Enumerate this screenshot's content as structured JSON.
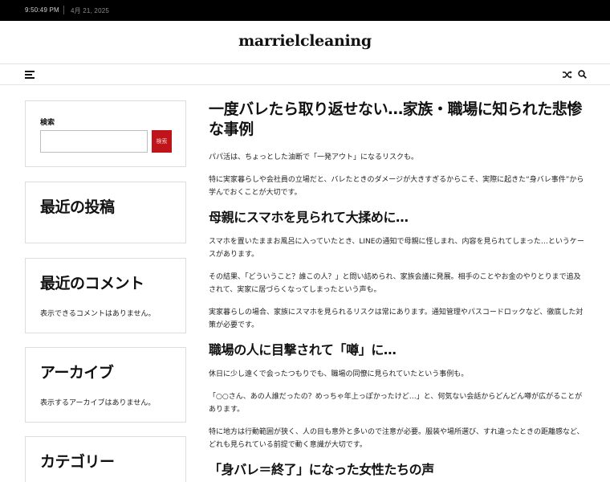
{
  "topbar": {
    "time": "9:50:49 PM",
    "date": "4月 21, 2025"
  },
  "site": {
    "title": "marrielcleaning"
  },
  "nav": {
    "menu_icon": "hamburger-menu-icon",
    "shuffle_icon": "shuffle-icon",
    "search_icon": "search-icon"
  },
  "sidebar": {
    "search": {
      "label": "検索",
      "input_value": "",
      "button_label": "検索",
      "button_color": "#c0141b"
    },
    "recent_posts": {
      "title": "最近の投稿"
    },
    "recent_comments": {
      "title": "最近のコメント",
      "empty_text": "表示できるコメントはありません。"
    },
    "archives": {
      "title": "アーカイブ",
      "empty_text": "表示するアーカイブはありません。"
    },
    "categories": {
      "title": "カテゴリー"
    }
  },
  "article": {
    "title": "一度バレたら取り返せない…家族・職場に知られた悲惨な事例",
    "blocks": [
      {
        "type": "p",
        "text": "パパ活は、ちょっとした油断で「一発アウト」になるリスクも。"
      },
      {
        "type": "p",
        "text": "特に実家暮らしや会社員の立場だと、バレたときのダメージが大きすぎるからこそ、実際に起きた“身バレ事件”から学んでおくことが大切です。"
      },
      {
        "type": "h2",
        "text": "母親にスマホを見られて大揉めに…"
      },
      {
        "type": "p",
        "text": "スマホを置いたままお風呂に入っていたとき、LINEの通知で母親に怪しまれ、内容を見られてしまった…というケースがあります。"
      },
      {
        "type": "p",
        "text": "その結果、「どういうこと？誰この人？」と問い詰められ、家族会議に発展。相手のことやお金のやりとりまで追及されて、実家に居づらくなってしまったという声も。"
      },
      {
        "type": "p",
        "text": "実家暮らしの場合、家族にスマホを見られるリスクは常にあります。通知管理やパスコードロックなど、徹底した対策が必要です。"
      },
      {
        "type": "h2",
        "text": "職場の人に目撃されて「噂」に…"
      },
      {
        "type": "p",
        "text": "休日に少し遠くで会ったつもりでも、職場の同僚に見られていたという事例も。"
      },
      {
        "type": "p",
        "text": "「○○さん、あの人誰だったの？めっちゃ年上っぽかったけど…」と、何気ない会話からどんどん噂が広がることがあります。"
      },
      {
        "type": "p",
        "text": "特に地方は行動範囲が狭く、人の目も意外と多いので注意が必要。服装や場所選び、すれ違ったときの距離感など、どれも見られている前提で動く意識が大切です。"
      },
      {
        "type": "h2",
        "text": "「身バレ＝終了」になった女性たちの声"
      }
    ]
  }
}
